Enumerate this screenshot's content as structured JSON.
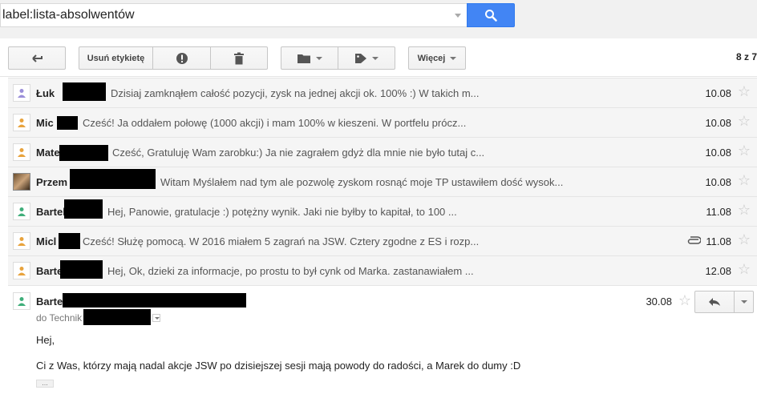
{
  "search": {
    "value": "label:lista-absolwentów"
  },
  "toolbar": {
    "remove_label": "Usuń etykietę",
    "more_label": "Więcej",
    "pager": "8 z 7"
  },
  "threads": [
    {
      "sender": "Łuk",
      "snippet": "Dzisiaj zamknąłem całość pozycji, zysk na jednej akcji ok. 100% :) W takich m...",
      "date": "10.08"
    },
    {
      "sender": "Mic",
      "snippet": "Cześć! Ja oddałem połowę (1000 akcji) i mam 100% w kieszeni. W portfelu prócz...",
      "date": "10.08"
    },
    {
      "sender": "Mate",
      "snippet": "Cześć, Gratuluję Wam zarobku:) Ja nie zagrałem gdyż dla mnie nie było tutaj c...",
      "date": "10.08"
    },
    {
      "sender": "Przem",
      "snippet": "Witam Myślałem nad tym ale pozwolę zyskom rosnąć moje TP ustawiłem dość wysok...",
      "date": "10.08"
    },
    {
      "sender": "Bartel",
      "snippet": "Hej, Panowie, gratulacje :) potężny wynik. Jaki nie byłby to kapitał, to 100 ...",
      "date": "11.08"
    },
    {
      "sender": "Micl",
      "snippet": "Cześć! Służę pomocą. W 2016 miałem 5 zagrań na JSW. Cztery zgodne z ES i rozp...",
      "date": "11.08"
    },
    {
      "sender": "Barte",
      "snippet": "Hej, Ok, dzieki za informacje, po prostu to był cynk od Marka. zastanawiałem ...",
      "date": "12.08"
    }
  ],
  "message": {
    "sender": "Barte",
    "to": "do Technik",
    "date": "30.08",
    "greeting": "Hej,",
    "body": "Ci z Was, którzy mają nadal akcje JSW po dzisiejszej sesji mają powody do radości, a Marek do dumy :D",
    "ellipsis": "..."
  },
  "colors": {
    "search_button": "#4285f4",
    "avatar_person": "#e8a33d",
    "avatar_person2": "#3fae7a",
    "avatar_person3": "#9b8fd9"
  }
}
